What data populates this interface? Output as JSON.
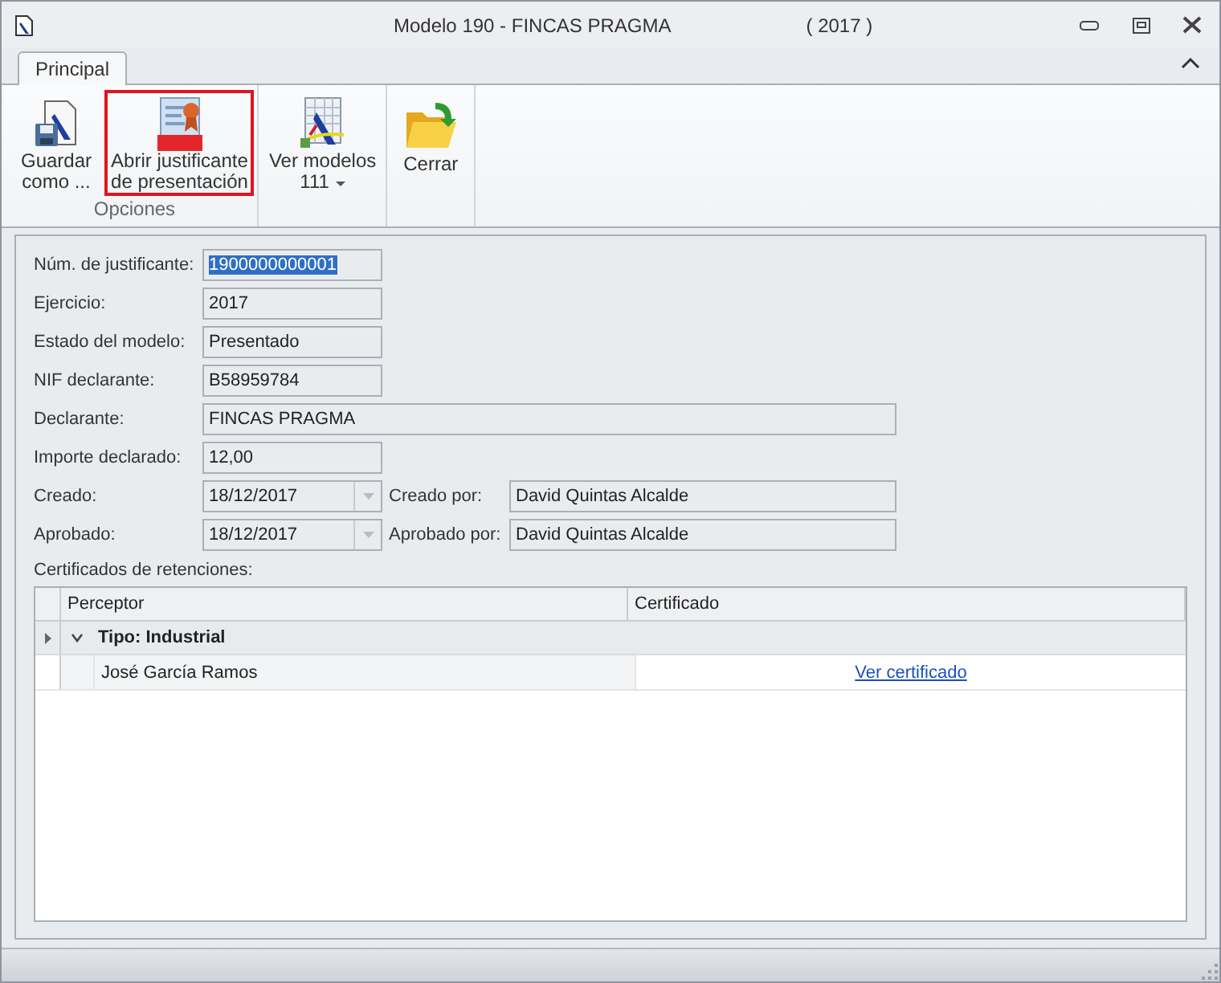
{
  "window": {
    "title": "Modelo 190 - FINCAS PRAGMA",
    "year": "( 2017 )"
  },
  "ribbon": {
    "tabs": [
      {
        "label": "Principal",
        "selected": true
      }
    ],
    "groups": [
      {
        "label": "Opciones",
        "buttons": [
          {
            "kind": "save",
            "lines": [
              "Guardar",
              "como ..."
            ],
            "highlighted": false
          },
          {
            "kind": "pdf",
            "lines": [
              "Abrir justificante",
              "de presentación"
            ],
            "highlighted": true
          }
        ]
      },
      {
        "buttons": [
          {
            "kind": "models",
            "lines": [
              "Ver modelos",
              "111"
            ],
            "highlighted": false,
            "dropdown": true
          }
        ]
      },
      {
        "buttons": [
          {
            "kind": "folder",
            "lines": [
              "Cerrar"
            ],
            "highlighted": false
          }
        ]
      }
    ]
  },
  "fields": [
    {
      "label": "Núm. de justificante:",
      "value": "1900000000001",
      "kind": "short",
      "selected": true
    },
    {
      "label": "Ejercicio:",
      "value": "2017",
      "kind": "short",
      "selected": false
    },
    {
      "label": "Estado del modelo:",
      "value": "Presentado",
      "kind": "short",
      "selected": false
    },
    {
      "label": "NIF declarante:",
      "value": "B58959784",
      "kind": "short",
      "selected": false
    },
    {
      "label": "Declarante:",
      "value": "FINCAS PRAGMA",
      "kind": "long",
      "selected": false
    },
    {
      "label": "Importe declarado:",
      "value": "12,00",
      "kind": "short",
      "selected": false
    },
    {
      "label": "Creado:",
      "value": "18/12/2017",
      "kind": "date",
      "selected": false,
      "by": {
        "label": "Creado por:",
        "value": "David Quintas Alcalde"
      }
    },
    {
      "label": "Aprobado:",
      "value": "18/12/2017",
      "kind": "date",
      "selected": false,
      "by": {
        "label": "Aprobado por:",
        "value": "David Quintas Alcalde"
      }
    }
  ],
  "certificates": {
    "title": "Certificados de retenciones:",
    "columns": [
      "Perceptor",
      "Certificado"
    ],
    "groups": [
      {
        "label": "Tipo: Industrial",
        "expanded": true,
        "focused": true,
        "rows": [
          {
            "perceptor": "José García Ramos",
            "certificado": "Ver certificado"
          }
        ]
      }
    ]
  }
}
